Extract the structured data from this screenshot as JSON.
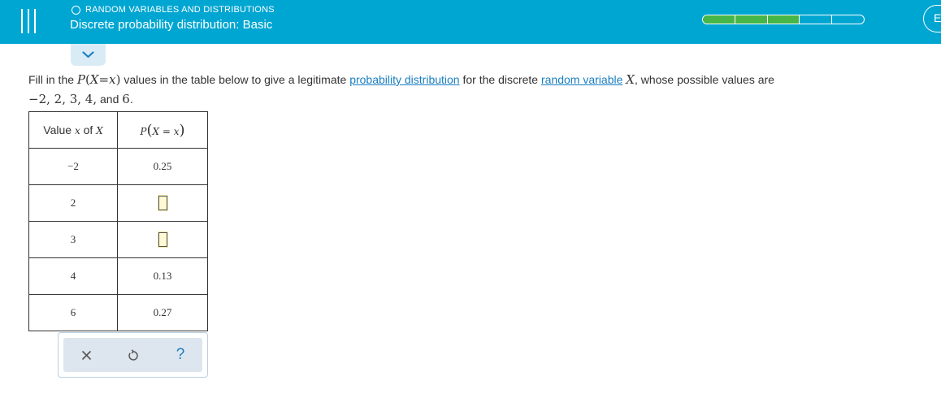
{
  "header": {
    "topic": "RANDOM VARIABLES AND DISTRIBUTIONS",
    "title": "Discrete probability distribution: Basic",
    "progress": {
      "segments_total": 5,
      "segments_completed": 3
    },
    "avatar_label": "E",
    "colors": {
      "bar": "#00a6d2",
      "progress_done": "#46b648"
    }
  },
  "question": {
    "intro": "Fill in the ",
    "p_symbol": "P",
    "p_arg": "X=x",
    "mid1": " values in the table below to give a legitimate ",
    "link1": "probability distribution",
    "mid2": " for the discrete ",
    "link2": "random variable",
    "var": "X",
    "mid3": ", whose possible values are",
    "values_text": "−2, 2, 3, 4,",
    "and_text": " and ",
    "last_value": "6",
    "end": "."
  },
  "table": {
    "header_col1_prefix": "Value ",
    "header_col1_var": "x",
    "header_col1_mid": " of ",
    "header_col1_X": "X",
    "header_col2_P": "P",
    "header_col2_inner": "X = x",
    "rows": [
      {
        "x": "−2",
        "p": "0.25",
        "input": false
      },
      {
        "x": "2",
        "p": "",
        "input": true
      },
      {
        "x": "3",
        "p": "",
        "input": true
      },
      {
        "x": "4",
        "p": "0.13",
        "input": false
      },
      {
        "x": "6",
        "p": "0.27",
        "input": false
      }
    ]
  },
  "actions": {
    "clear_icon": "x-icon",
    "undo_icon": "undo-icon",
    "help_label": "?",
    "accent": "#1a7ec0"
  }
}
